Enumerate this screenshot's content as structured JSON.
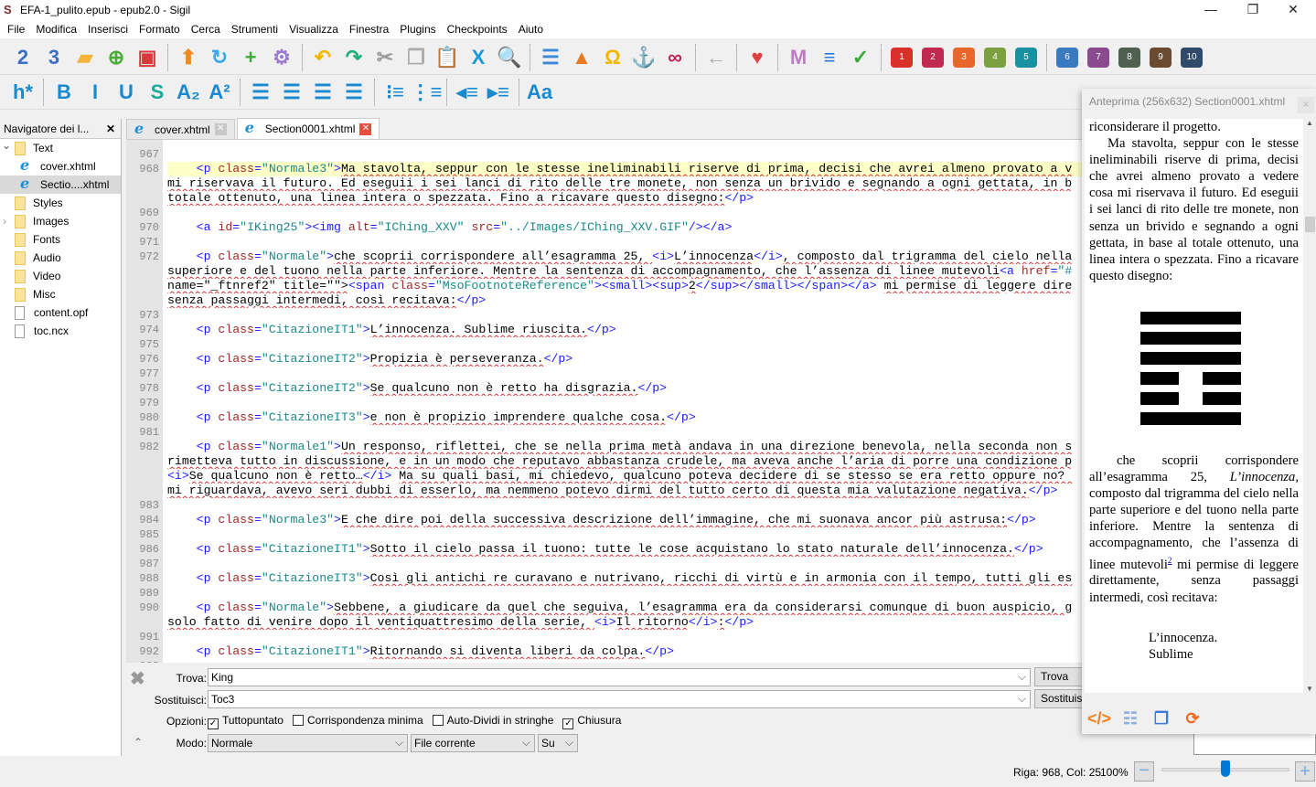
{
  "window": {
    "title": "EFA-1_pulito.epub - epub2.0 - Sigil",
    "app_icon": "sigil-icon"
  },
  "menu": [
    "File",
    "Modifica",
    "Inserisci",
    "Formato",
    "Cerca",
    "Strumenti",
    "Visualizza",
    "Finestra",
    "Plugins",
    "Checkpoints",
    "Aiuto"
  ],
  "toolbar1": [
    {
      "icon": "new-epub2-icon",
      "glyph": "2",
      "color": "#3a6fc8"
    },
    {
      "icon": "new-epub3-icon",
      "glyph": "3",
      "color": "#3a6fc8"
    },
    {
      "icon": "open-folder-icon",
      "glyph": "▰",
      "color": "#f2b53a"
    },
    {
      "icon": "add-file-icon",
      "glyph": "⊕",
      "color": "#4caa3a"
    },
    {
      "icon": "save-icon",
      "glyph": "▣",
      "color": "#d9363e",
      "sep_after": true
    },
    {
      "icon": "arrow-up-icon",
      "glyph": "⬆",
      "color": "#f08a20"
    },
    {
      "icon": "refresh-icon",
      "glyph": "↻",
      "color": "#3aa8e8"
    },
    {
      "icon": "add-item-icon",
      "glyph": "+",
      "color": "#3aaa3a"
    },
    {
      "icon": "gear-icon",
      "glyph": "⚙",
      "color": "#9a7ad0",
      "sep_after": true
    },
    {
      "icon": "undo-icon",
      "glyph": "↶",
      "color": "#f2b800"
    },
    {
      "icon": "redo-icon",
      "glyph": "↷",
      "color": "#1cb07a"
    },
    {
      "icon": "cut-icon",
      "glyph": "✂",
      "color": "#999"
    },
    {
      "icon": "copy-icon",
      "glyph": "❐",
      "color": "#aaa"
    },
    {
      "icon": "paste-icon",
      "glyph": "📋",
      "color": "#3a6fc8"
    },
    {
      "icon": "clean-code-icon",
      "glyph": "X",
      "color": "#1a9ad8"
    },
    {
      "icon": "search-icon",
      "glyph": "🔍",
      "color": "#2a8ad8",
      "sep_after": true
    },
    {
      "icon": "split-icon",
      "glyph": "☰",
      "color": "#3a8ad8"
    },
    {
      "icon": "insert-image-icon",
      "glyph": "▲",
      "color": "#e87a20"
    },
    {
      "icon": "omega-icon",
      "glyph": "Ω",
      "color": "#f2b800"
    },
    {
      "icon": "anchor-icon",
      "glyph": "⚓",
      "color": "#1a9ad8"
    },
    {
      "icon": "link-icon",
      "glyph": "∞",
      "color": "#c0205a",
      "sep_after": true
    },
    {
      "icon": "back-arrow-icon",
      "glyph": "←",
      "color": "#aaa",
      "sep_after": true
    },
    {
      "icon": "heart-icon",
      "glyph": "♥",
      "color": "#e04040",
      "sep_after": true
    },
    {
      "icon": "metadata-icon",
      "glyph": "M",
      "color": "#c07ac8"
    },
    {
      "icon": "toc-list-icon",
      "glyph": "≡",
      "color": "#2a7ad8"
    },
    {
      "icon": "spellcheck-icon",
      "glyph": "✓",
      "color": "#3aaa3a",
      "sep_after": true
    }
  ],
  "plugins": [
    {
      "label": "1",
      "color": "#d9302a"
    },
    {
      "label": "2",
      "color": "#c02a50"
    },
    {
      "label": "3",
      "color": "#e8662a"
    },
    {
      "label": "4",
      "color": "#7aa040"
    },
    {
      "label": "5",
      "color": "#1a90a0"
    },
    {
      "label": "6",
      "color": "#3a7ac0"
    },
    {
      "label": "7",
      "color": "#8a4a90"
    },
    {
      "label": "8",
      "color": "#506050"
    },
    {
      "label": "9",
      "color": "#6a4a30"
    },
    {
      "label": "10",
      "color": "#304a6a"
    }
  ],
  "toolbar2": [
    {
      "icon": "heading-icon",
      "glyph": "h*",
      "color": "#1a8ad0",
      "sep_after": true
    },
    {
      "icon": "bold-icon",
      "glyph": "B",
      "color": "#1a8ad0"
    },
    {
      "icon": "italic-icon",
      "glyph": "I",
      "color": "#1a8ad0"
    },
    {
      "icon": "underline-icon",
      "glyph": "U",
      "color": "#1a8ad0"
    },
    {
      "icon": "strikethrough-icon",
      "glyph": "S",
      "color": "#1aaa9a"
    },
    {
      "icon": "subscript-icon",
      "glyph": "A₂",
      "color": "#1a8ad0"
    },
    {
      "icon": "superscript-icon",
      "glyph": "A²",
      "color": "#1a8ad0",
      "sep_after": true
    },
    {
      "icon": "align-left-icon",
      "glyph": "☰",
      "color": "#1a8ad0"
    },
    {
      "icon": "align-center-icon",
      "glyph": "☰",
      "color": "#1a8ad0"
    },
    {
      "icon": "align-right-icon",
      "glyph": "☰",
      "color": "#1a8ad0"
    },
    {
      "icon": "align-justify-icon",
      "glyph": "☰",
      "color": "#1a8ad0",
      "sep_after": true
    },
    {
      "icon": "bullet-list-icon",
      "glyph": "⁝≡",
      "color": "#1a8ad0"
    },
    {
      "icon": "numbered-list-icon",
      "glyph": "⋮≡",
      "color": "#1a8ad0",
      "sep_after": true
    },
    {
      "icon": "outdent-icon",
      "glyph": "◂≡",
      "color": "#1a8ad0"
    },
    {
      "icon": "indent-icon",
      "glyph": "▸≡",
      "color": "#1a8ad0",
      "sep_after": true
    },
    {
      "icon": "case-icon",
      "glyph": "Aa",
      "color": "#1a8ad0"
    }
  ],
  "navigator": {
    "title": "Navigatore dei l...",
    "items": [
      {
        "label": "Text",
        "type": "folder",
        "expanded": true,
        "level": 0
      },
      {
        "label": "cover.xhtml",
        "type": "xhtml",
        "level": 1
      },
      {
        "label": "Sectio....xhtml",
        "type": "xhtml",
        "level": 1,
        "selected": true
      },
      {
        "label": "Styles",
        "type": "folder",
        "level": 0
      },
      {
        "label": "Images",
        "type": "folder",
        "collapsed": true,
        "level": 0
      },
      {
        "label": "Fonts",
        "type": "folder",
        "level": 0
      },
      {
        "label": "Audio",
        "type": "folder",
        "level": 0
      },
      {
        "label": "Video",
        "type": "folder",
        "level": 0
      },
      {
        "label": "Misc",
        "type": "folder",
        "level": 0
      },
      {
        "label": "content.opf",
        "type": "file",
        "level": 0
      },
      {
        "label": "toc.ncx",
        "type": "file",
        "level": 0
      }
    ]
  },
  "tabs": [
    {
      "label": "cover.xhtml",
      "active": false
    },
    {
      "label": "Section0001.xhtml",
      "active": true
    }
  ],
  "code": {
    "current_line": "968",
    "rows": [
      {
        "n": "967",
        "t": ""
      },
      {
        "n": "968",
        "t": "    <p class=\"Normale3\">Ma stavolta, seppur con le stesse ineliminabili riserve di prima, decisi che avrei almeno provato a v"
      },
      {
        "n": "",
        "t": "mi riservava il futuro. Ed eseguii i sei lanci di rito delle tre monete, non senza un brivido e segnando a ogni gettata, in b"
      },
      {
        "n": "",
        "t": "totale ottenuto, una linea intera o spezzata. Fino a ricavare questo disegno:</p>"
      },
      {
        "n": "969",
        "t": ""
      },
      {
        "n": "970",
        "t": "    <a id=\"IKing25\"><img alt=\"IChing_XXV\" src=\"../Images/IChing_XXV.GIF\"/></a>"
      },
      {
        "n": "971",
        "t": ""
      },
      {
        "n": "972",
        "t": "    <p class=\"Normale\">che scoprii corrispondere all’esagramma 25, <i>L’innocenza</i>, composto dal trigramma del cielo nella"
      },
      {
        "n": "",
        "t": "superiore e del tuono nella parte inferiore. Mentre la sentenza di accompagnamento, che l’assenza di linee mutevoli<a href=\"#"
      },
      {
        "n": "",
        "t": "name=\"_ftnref2\" title=\"\"><span class=\"MsoFootnoteReference\"><small><sup>2</sup></small></span></a> mi permise di leggere dire"
      },
      {
        "n": "",
        "t": "senza passaggi intermedi, così recitava:</p>"
      },
      {
        "n": "973",
        "t": ""
      },
      {
        "n": "974",
        "t": "    <p class=\"CitazioneIT1\">L’innocenza. Sublime riuscita.</p>"
      },
      {
        "n": "975",
        "t": ""
      },
      {
        "n": "976",
        "t": "    <p class=\"CitazioneIT2\">Propizia è perseveranza.</p>"
      },
      {
        "n": "977",
        "t": ""
      },
      {
        "n": "978",
        "t": "    <p class=\"CitazioneIT2\">Se qualcuno non è retto ha disgrazia.</p>"
      },
      {
        "n": "979",
        "t": ""
      },
      {
        "n": "980",
        "t": "    <p class=\"CitazioneIT3\">e non è propizio imprendere qualche cosa.</p>"
      },
      {
        "n": "981",
        "t": ""
      },
      {
        "n": "982",
        "t": "    <p class=\"Normale1\">Un responso, riflettei, che se nella prima metà andava in una direzione benevola, nella seconda non s"
      },
      {
        "n": "",
        "t": "rimetteva tutto in discussione, e in un modo che reputavo abbastanza crudele, ma aveva anche l’aria di porre una condizione p"
      },
      {
        "n": "",
        "t": "<i>Se qualcuno non è retto…</i> Ma su quali basi, mi chiedevo, qualcuno poteva decidere di se stesso se era retto oppure no? "
      },
      {
        "n": "",
        "t": "mi riguardava, avevo seri dubbi di esserlo, ma nemmeno potevo dirmi del tutto certo di questa mia valutazione negativa.</p>"
      },
      {
        "n": "983",
        "t": ""
      },
      {
        "n": "984",
        "t": "    <p class=\"Normale3\">E che dire poi della successiva descrizione dell’immagine, che mi suonava ancor più astrusa:</p>"
      },
      {
        "n": "985",
        "t": ""
      },
      {
        "n": "986",
        "t": "    <p class=\"CitazioneIT1\">Sotto il cielo passa il tuono: tutte le cose acquistano lo stato naturale dell’innocenza.</p>"
      },
      {
        "n": "987",
        "t": ""
      },
      {
        "n": "988",
        "t": "    <p class=\"CitazioneIT3\">Così gli antichi re curavano e nutrivano, ricchi di virtù e in armonia con il tempo, tutti gli es"
      },
      {
        "n": "989",
        "t": ""
      },
      {
        "n": "990",
        "t": "    <p class=\"Normale\">Sebbene, a giudicare da quel che seguiva, l’esagramma era da considerarsi comunque di buon auspicio, g"
      },
      {
        "n": "",
        "t": "solo fatto di venire dopo il ventiquattresimo della serie, <i>Il ritorno</i>:</p>"
      },
      {
        "n": "991",
        "t": ""
      },
      {
        "n": "992",
        "t": "    <p class=\"CitazioneIT1\">Ritornando si diventa liberi da colpa.</p>"
      },
      {
        "n": "993",
        "t": ""
      }
    ]
  },
  "find": {
    "find_label": "Trova:",
    "find_value": "King",
    "find_button": "Trova",
    "replace_label": "Sostituisci:",
    "replace_value": "Toc3",
    "replace_button": "Sostituisci",
    "options_label": "Opzioni:",
    "options": [
      {
        "label": "Tuttopuntato",
        "checked": true
      },
      {
        "label": "Corrispondenza minima",
        "checked": false
      },
      {
        "label": "Auto-Dividi in stringhe",
        "checked": false
      },
      {
        "label": "Chiusura",
        "checked": true
      }
    ],
    "mode_label": "Modo:",
    "mode_value": "Normale",
    "scope_value": "File corrente",
    "direction_value": "Su"
  },
  "preview": {
    "title": "Anteprima (256x632) Section0001.xhtml",
    "close": "×",
    "p1": "riconsiderare il progetto.",
    "p2": "Ma stavolta, seppur con le stesse ineliminabili riserve di prima, decisi che avrei almeno provato a vedere cosa mi riservava il futuro. Ed eseguii i sei lanci di rito delle tre monete, non senza un brivido e segnando a ogni gettata, in base al totale ottenuto, una linea intera o spezzata. Fino a ricavare questo disegno:",
    "hexagram_lines_top_to_bottom": [
      "solid",
      "solid",
      "solid",
      "broken",
      "broken",
      "solid"
    ],
    "p3_before": "che scoprii corrispondere all’esagramma 25, ",
    "p3_italic": "L’innocenza",
    "p3_middle": ", composto dal trigramma del cielo nella parte superiore e del tuono nella parte inferiore. Mentre la sentenza di accompagnamento, che l’assenza di linee mutevoli",
    "p3_footnote": "2",
    "p3_after": " mi permise di leggere direttamente, senza passaggi intermedi, così recitava:",
    "quote1": "L’innocenza.",
    "quote2": "Sublime"
  },
  "status": {
    "position": "Riga: 968, Col: 25",
    "zoom": "100%",
    "zoom_level_percent": 100
  }
}
